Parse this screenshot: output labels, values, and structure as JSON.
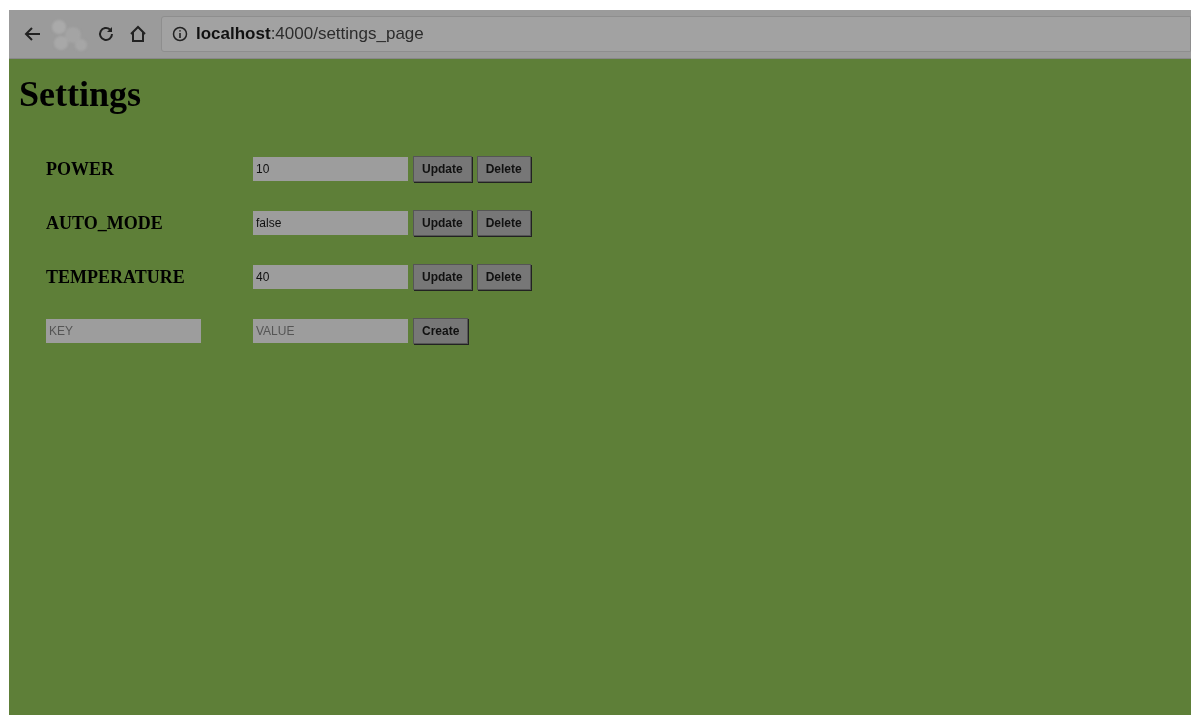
{
  "browser": {
    "url": "**localhost**:4000/settings_page"
  },
  "page": {
    "title": "Settings",
    "settings": [
      {
        "key": "POWER",
        "value": "10",
        "update": "Update",
        "delete": "Delete"
      },
      {
        "key": "AUTO_MODE",
        "value": "false",
        "update": "Update",
        "delete": "Delete"
      },
      {
        "key": "TEMPERATURE",
        "value": "40",
        "update": "Update",
        "delete": "Delete"
      }
    ],
    "new_setting": {
      "key_placeholder": "KEY",
      "value_placeholder": "VALUE",
      "button": "Create"
    }
  }
}
